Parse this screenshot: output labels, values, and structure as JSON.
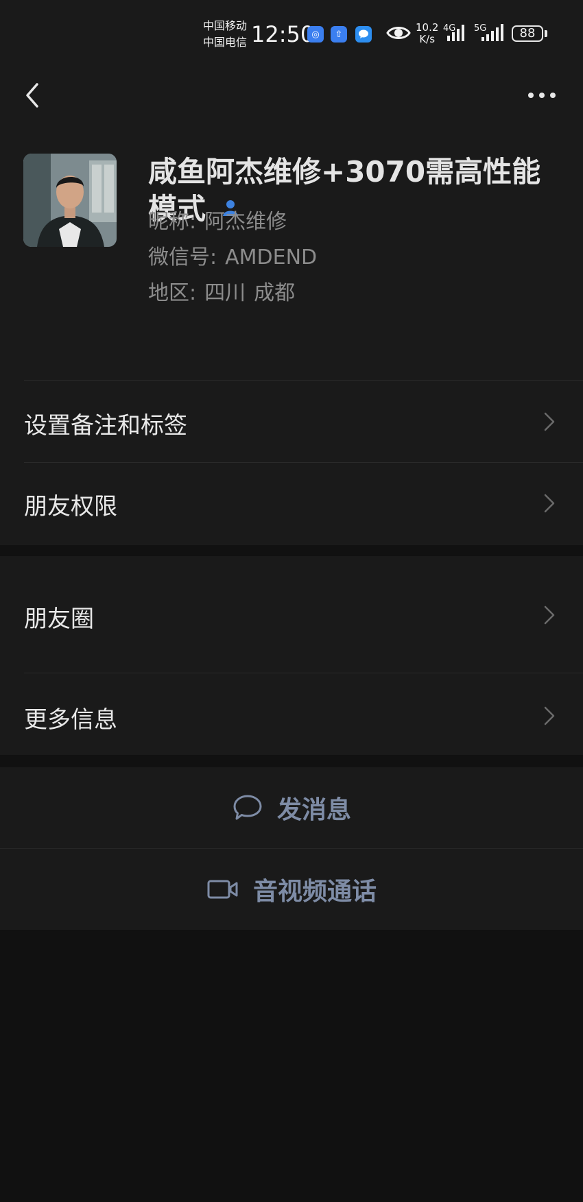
{
  "status_bar": {
    "carrier_1": "中国移动",
    "carrier_2": "中国电信",
    "time": "12:50",
    "net_speed_value": "10.2",
    "net_speed_unit": "K/s",
    "signal_1_label": "4G",
    "signal_2_label": "5G",
    "battery": "88",
    "icons": [
      "app-notification-icon",
      "upload-icon",
      "message-icon",
      "eye-icon",
      "signal-icon",
      "battery-icon"
    ]
  },
  "nav": {
    "back_icon": "chevron-left-icon",
    "more_icon": "more-dots-icon"
  },
  "profile": {
    "display_name": "咸鱼阿杰维修+3070需高性能模式",
    "nickname_label": "昵称:",
    "nickname": "阿杰维修",
    "wechat_id_label": "微信号:",
    "wechat_id": "AMDEND",
    "region_label": "地区:",
    "region_province": "四川",
    "region_city": "成都",
    "badge_icon": "contact-person-icon"
  },
  "menu": {
    "remark_tags": "设置备注和标签",
    "friend_permissions": "朋友权限",
    "moments": "朋友圈",
    "more_info": "更多信息"
  },
  "actions": {
    "send_message": "发消息",
    "video_call": "音视频通话"
  },
  "colors": {
    "background": "#111111",
    "card": "#1a1a1a",
    "action_text": "#7e8ca6",
    "badge_blue": "#3d82e0"
  }
}
